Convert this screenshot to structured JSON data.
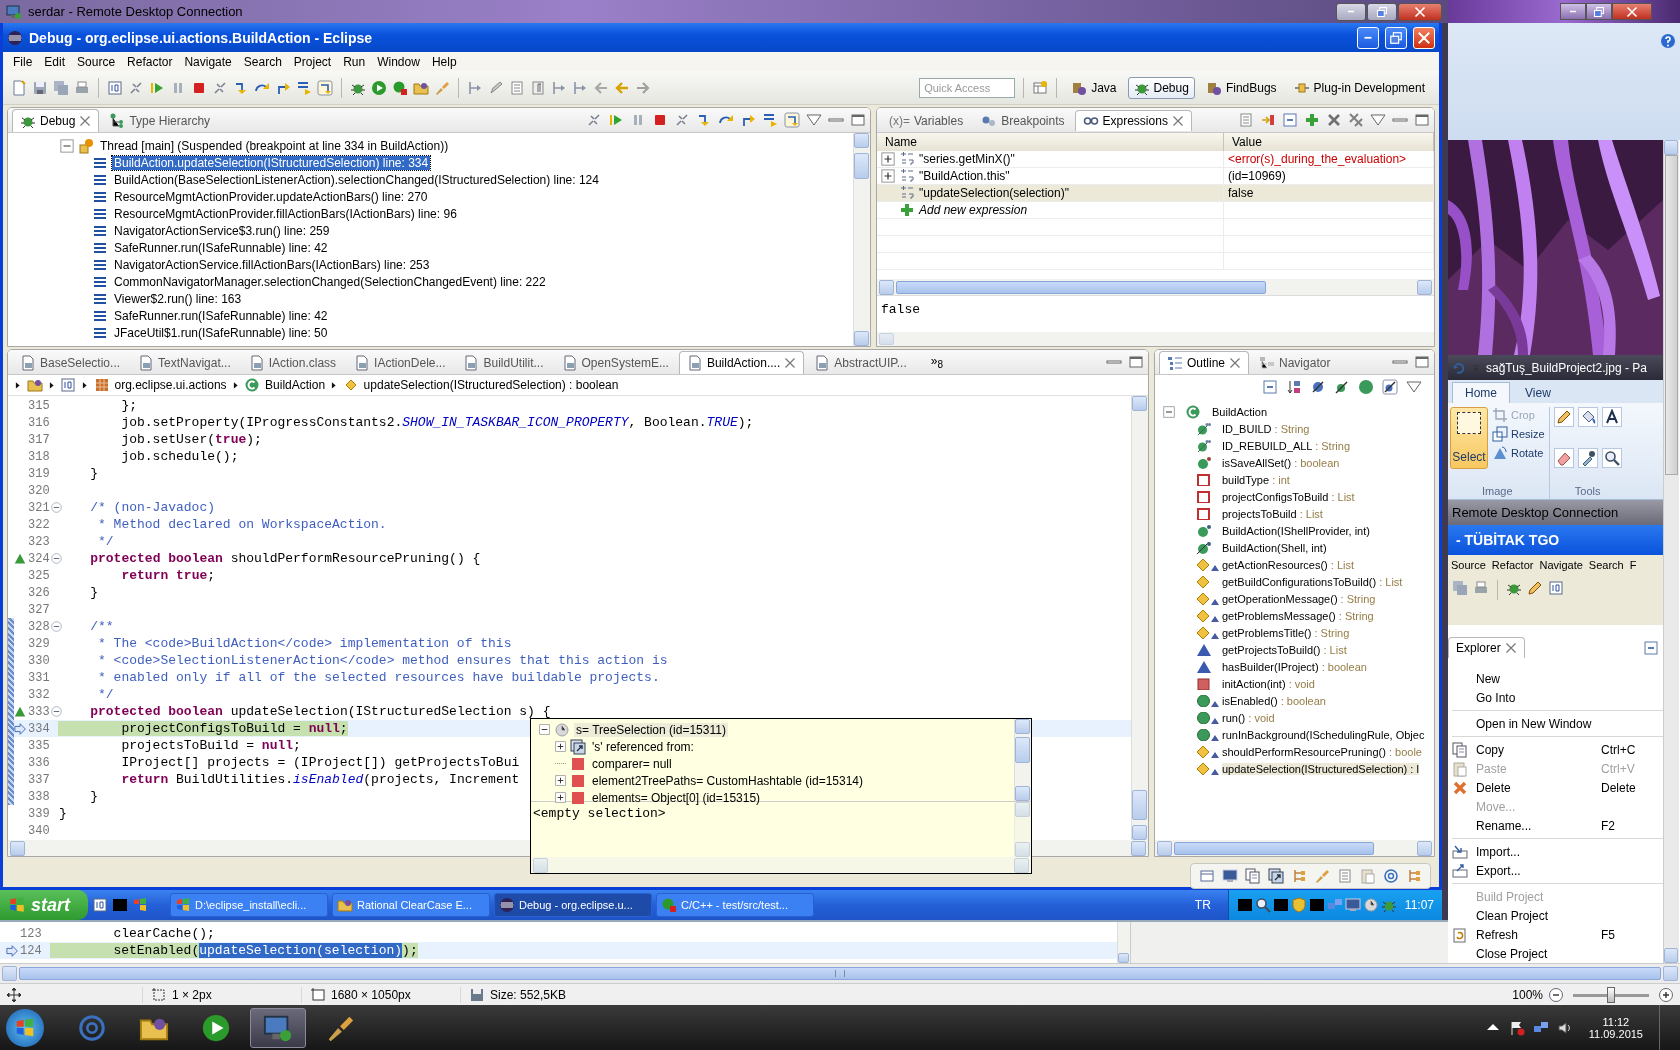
{
  "rdc_window": {
    "title": "serdar - Remote Desktop Connection"
  },
  "eclipse": {
    "title": "Debug - org.eclipse.ui.actions.BuildAction - Eclipse",
    "menu": [
      "File",
      "Edit",
      "Source",
      "Refactor",
      "Navigate",
      "Search",
      "Project",
      "Run",
      "Window",
      "Help"
    ],
    "quick_access": {
      "placeholder": "Quick Access"
    },
    "perspectives": [
      {
        "label": "Java",
        "selected": false
      },
      {
        "label": "Debug",
        "selected": true
      },
      {
        "label": "FindBugs",
        "selected": false
      },
      {
        "label": "Plug-in Development",
        "selected": false
      }
    ]
  },
  "debug_view": {
    "tabs": [
      {
        "label": "Debug",
        "selected": true
      },
      {
        "label": "Type Hierarchy",
        "selected": false
      }
    ],
    "thread": {
      "label": "Thread [main] (Suspended (breakpoint at line 334 in BuildAction))",
      "expanded": true,
      "frames": [
        {
          "label": "BuildAction.updateSelection(IStructuredSelection) line: 334",
          "selected": true
        },
        {
          "label": "BuildAction(BaseSelectionListenerAction).selectionChanged(IStructuredSelection) line: 124",
          "selected": false
        },
        {
          "label": "ResourceMgmtActionProvider.updateActionBars() line: 270",
          "selected": false
        },
        {
          "label": "ResourceMgmtActionProvider.fillActionBars(IActionBars) line: 96",
          "selected": false
        },
        {
          "label": "NavigatorActionService$3.run() line: 259",
          "selected": false
        },
        {
          "label": "SafeRunner.run(ISafeRunnable) line: 42",
          "selected": false
        },
        {
          "label": "NavigatorActionService.fillActionBars(IActionBars) line: 253",
          "selected": false
        },
        {
          "label": "CommonNavigatorManager.selectionChanged(SelectionChangedEvent) line: 222",
          "selected": false
        },
        {
          "label": "Viewer$2.run() line: 163",
          "selected": false
        },
        {
          "label": "SafeRunner.run(ISafeRunnable) line: 42",
          "selected": false
        },
        {
          "label": "JFaceUtil$1.run(ISafeRunnable) line: 50",
          "selected": false
        }
      ]
    }
  },
  "expressions_view": {
    "tabs": [
      {
        "label": "Variables",
        "icon_text": "(x)=",
        "selected": false
      },
      {
        "label": "Breakpoints",
        "selected": false
      },
      {
        "label": "Expressions",
        "selected": true
      }
    ],
    "columns": [
      "Name",
      "Value"
    ],
    "rows": [
      {
        "name": "\"series.getMinX()\"",
        "value": "<error(s)_during_the_evaluation>",
        "error": true,
        "expandable": true,
        "selected": false
      },
      {
        "name": "\"BuildAction.this\"",
        "value": "(id=10969)",
        "error": false,
        "expandable": true,
        "selected": false
      },
      {
        "name": "\"updateSelection(selection)\"",
        "value": "false",
        "error": false,
        "expandable": false,
        "selected": true
      }
    ],
    "add_row": "Add new expression",
    "detail": "false"
  },
  "editor": {
    "tabs": [
      {
        "label": "BaseSelectio...",
        "selected": false
      },
      {
        "label": "TextNavigat...",
        "selected": false
      },
      {
        "label": "IAction.class",
        "selected": false
      },
      {
        "label": "IActionDele...",
        "selected": false
      },
      {
        "label": "BuildUtilit...",
        "selected": false
      },
      {
        "label": "OpenSystemE...",
        "selected": false
      },
      {
        "label": "BuildAction....",
        "selected": true
      },
      {
        "label": "AbstractUIP...",
        "selected": false
      }
    ],
    "overflow_icon": "»",
    "overflow_count": "8",
    "breadcrumb": [
      {
        "kind": "package",
        "label": "org.eclipse.ui.actions"
      },
      {
        "kind": "class",
        "label": "BuildAction"
      },
      {
        "kind": "method",
        "label": "updateSelection(IStructuredSelection) : boolean"
      }
    ],
    "lines": [
      {
        "number": "315",
        "code": "        };"
      },
      {
        "number": "316",
        "code": "        job.setProperty(IProgressConstants2.*SHOW_IN_TASKBAR_ICON_PROPERTY*, Boolean.*TRUE*);"
      },
      {
        "number": "317",
        "code": "        job.setUser(**true**);"
      },
      {
        "number": "318",
        "code": "        job.schedule();"
      },
      {
        "number": "319",
        "code": "    }"
      },
      {
        "number": "320"
      },
      {
        "number": "321",
        "code": "    /* (non-Javadoc)",
        "kind": "comment",
        "folding": true
      },
      {
        "number": "322",
        "code": "     * Method declared on WorkspaceAction.",
        "kind": "comment"
      },
      {
        "number": "323",
        "code": "     */",
        "kind": "comment"
      },
      {
        "number": "324",
        "code": "    **protected** **boolean** shouldPerformResourcePruning() {",
        "overrides": true,
        "folding": true
      },
      {
        "number": "325",
        "code": "        **return** **true**;"
      },
      {
        "number": "326",
        "code": "    }"
      },
      {
        "number": "327"
      },
      {
        "number": "328",
        "code": "    /**",
        "kind": "comment",
        "folding": true,
        "changed": true
      },
      {
        "number": "329",
        "code": "     * The <code>BuildAction</code> implementation of this",
        "kind": "comment",
        "changed": true
      },
      {
        "number": "330",
        "code": "     * <code>SelectionListenerAction</code> method ensures that this action is",
        "kind": "comment",
        "changed": true
      },
      {
        "number": "331",
        "code": "     * enabled only if all of the selected resources have buildable projects.",
        "kind": "comment",
        "changed": true
      },
      {
        "number": "332",
        "code": "     */",
        "kind": "comment",
        "changed": true
      },
      {
        "number": "333",
        "code": "    **protected** **boolean** updateSelection(IStructuredSelection s) {",
        "overrides": true,
        "folding": true,
        "changed": true
      },
      {
        "number": "334",
        "code": "        projectConfigsToBuild = **null**;",
        "pointer": true,
        "current": true,
        "changed": true
      },
      {
        "number": "335",
        "code": "        projectsToBuild = **null**;",
        "changed": true
      },
      {
        "number": "336",
        "code": "        IProject[] projects = (IProject[]) getProjectsToBui",
        "changed": true
      },
      {
        "number": "337",
        "code": "        **return** BuildUtilities.*isEnabled*(projects, Increment",
        "changed": true
      },
      {
        "number": "338",
        "code": "    }",
        "changed": true
      },
      {
        "number": "339",
        "code": "}"
      },
      {
        "number": "340"
      }
    ]
  },
  "inspect_popup": {
    "root": {
      "label": "s= TreeSelection  (id=15311)",
      "expanded": true,
      "selected": true,
      "children": [
        {
          "kind": "references",
          "label": "'s' referenced from:",
          "expandable": true
        },
        {
          "kind": "field",
          "label": "comparer= null",
          "expandable": false
        },
        {
          "kind": "field",
          "label": "element2TreePaths= CustomHashtable  (id=15314)",
          "expandable": true
        },
        {
          "kind": "field",
          "label": "elements= Object[0]  (id=15315)",
          "expandable": true
        }
      ]
    },
    "detail": "<empty selection>"
  },
  "outline_view": {
    "tabs": [
      {
        "label": "Outline",
        "selected": true
      },
      {
        "label": "Navigator",
        "selected": false
      }
    ],
    "root": {
      "label": "BuildAction",
      "expanded": true,
      "children": [
        {
          "kind": "constant",
          "label": "ID_BUILD",
          "type": " : String",
          "overrides": false,
          "selected": false
        },
        {
          "kind": "constant",
          "label": "ID_REBUILD_ALL",
          "type": " : String",
          "overrides": false,
          "selected": false
        },
        {
          "kind": "static-method",
          "label": "isSaveAllSet()",
          "type": " : boolean",
          "overrides": false,
          "selected": false
        },
        {
          "kind": "field",
          "label": "buildType",
          "type": " : int",
          "overrides": false,
          "selected": false
        },
        {
          "kind": "field",
          "label": "projectConfigsToBuild",
          "type": " : List",
          "overrides": false,
          "selected": false
        },
        {
          "kind": "field",
          "label": "projectsToBuild",
          "type": " : List",
          "overrides": false,
          "selected": false
        },
        {
          "kind": "constructor",
          "label": "BuildAction(IShellProvider, int)",
          "overrides": false,
          "selected": false
        },
        {
          "kind": "deprecated-constructor",
          "label": "BuildAction(Shell, int)",
          "overrides": false,
          "selected": false
        },
        {
          "kind": "protected",
          "label": "getActionResources()",
          "type": " : List",
          "overrides": true,
          "selected": false
        },
        {
          "kind": "protected",
          "label": "getBuildConfigurationsToBuild()",
          "type": " : List",
          "overrides": false,
          "selected": false
        },
        {
          "kind": "protected",
          "label": "getOperationMessage()",
          "type": " : String",
          "overrides": true,
          "selected": false
        },
        {
          "kind": "protected",
          "label": "getProblemsMessage()",
          "type": " : String",
          "overrides": true,
          "selected": false
        },
        {
          "kind": "protected",
          "label": "getProblemsTitle()",
          "type": " : String",
          "overrides": true,
          "selected": false
        },
        {
          "kind": "package",
          "label": "getProjectsToBuild()",
          "type": " : List",
          "overrides": false,
          "selected": false
        },
        {
          "kind": "package",
          "label": "hasBuilder(IProject)",
          "type": " : boolean",
          "overrides": false,
          "selected": false
        },
        {
          "kind": "private",
          "label": "initAction(int)",
          "type": " : void",
          "overrides": false,
          "selected": false
        },
        {
          "kind": "public",
          "label": "isEnabled()",
          "type": " : boolean",
          "overrides": true,
          "selected": false
        },
        {
          "kind": "public",
          "label": "run()",
          "type": " : void",
          "overrides": true,
          "selected": false
        },
        {
          "kind": "public",
          "label": "runInBackground(ISchedulingRule, Objec",
          "overrides": true,
          "selected": false
        },
        {
          "kind": "protected",
          "label": "shouldPerformResourcePruning()",
          "type": " : boole",
          "overrides": true,
          "selected": false
        },
        {
          "kind": "protected",
          "label": "updateSelection(IStructuredSelection) : l",
          "overrides": true,
          "selected": true
        }
      ]
    }
  },
  "xp_taskbar": {
    "start": "start",
    "tasks": [
      {
        "label": "D:\\eclipse_install\\ecli...",
        "kind": "eclipse",
        "selected": false
      },
      {
        "label": "Rational ClearCase E...",
        "kind": "clearcase",
        "selected": false
      },
      {
        "label": "Debug - org.eclipse.u...",
        "kind": "eclipse-debug",
        "selected": true
      },
      {
        "label": "C/C++ - test/src/test...",
        "kind": "cpp",
        "selected": false
      }
    ],
    "language": "TR",
    "clock": "11:07"
  },
  "lower_editor": {
    "lines": [
      {
        "number": "123",
        "before": "        clearCache();",
        "pointer": false,
        "current": false
      },
      {
        "number": "124",
        "before": "        setEnabled(",
        "selected_text": "updateSelection(selection)",
        "after": ");",
        "pointer": true,
        "current": true
      }
    ]
  },
  "paint": {
    "title": "sağTuş_BuildProject2.jpg - Pa",
    "tabs": [
      {
        "label": "Home",
        "selected": true
      },
      {
        "label": "View",
        "selected": false
      }
    ],
    "select_tool": {
      "label": "Select",
      "selected": true
    },
    "image_tools": [
      {
        "kind": "crop",
        "label": "Crop",
        "disabled": true
      },
      {
        "kind": "resize",
        "label": "Resize",
        "disabled": false
      },
      {
        "kind": "rotate",
        "label": "Rotate",
        "disabled": false
      }
    ],
    "groups": [
      "Image",
      "Tools"
    ]
  },
  "remote_bar": {
    "title": "Remote Desktop Connection"
  },
  "tgo_window": {
    "title": "- TÜBİTAK TGO",
    "menu": [
      "Source",
      "Refactor",
      "Navigate",
      "Search",
      "F"
    ],
    "explorer_tab": "Explorer"
  },
  "context_menu": {
    "groups": [
      [
        {
          "label": "New",
          "disabled": false
        },
        {
          "label": "Go Into",
          "disabled": false
        }
      ],
      [
        {
          "label": "Open in New Window",
          "disabled": false
        }
      ],
      [
        {
          "label": "Copy",
          "kind": "copy",
          "shortcut": "Ctrl+C",
          "disabled": false
        },
        {
          "label": "Paste",
          "kind": "paste",
          "shortcut": "Ctrl+V",
          "disabled": true
        },
        {
          "label": "Delete",
          "kind": "delete",
          "shortcut": "Delete",
          "disabled": false
        },
        {
          "label": "Move...",
          "disabled": true
        },
        {
          "label": "Rename...",
          "shortcut": "F2",
          "disabled": false
        }
      ],
      [
        {
          "label": "Import...",
          "kind": "import",
          "disabled": false
        },
        {
          "label": "Export...",
          "kind": "export",
          "disabled": false
        }
      ],
      [
        {
          "label": "Build Project",
          "disabled": true
        },
        {
          "label": "Clean Project",
          "disabled": false
        },
        {
          "label": "Refresh",
          "kind": "refresh",
          "shortcut": "F5",
          "disabled": false
        },
        {
          "label": "Close Project",
          "disabled": false
        }
      ]
    ]
  },
  "paint_status": {
    "selection_size": "1 × 2px",
    "image_size": "1680 × 1050px",
    "file_size": "Size: 552,5KB",
    "zoom": "100%",
    "zoom_slider": {
      "level": 0.5
    }
  },
  "win7_taskbar": {
    "apps": [
      {
        "kind": "ie",
        "selected": false
      },
      {
        "kind": "explorer",
        "selected": false
      },
      {
        "kind": "media",
        "selected": false
      },
      {
        "kind": "remote-desktop",
        "selected": true
      },
      {
        "kind": "paint",
        "selected": false
      }
    ],
    "time": "11:12",
    "date": "11.09.2015"
  }
}
